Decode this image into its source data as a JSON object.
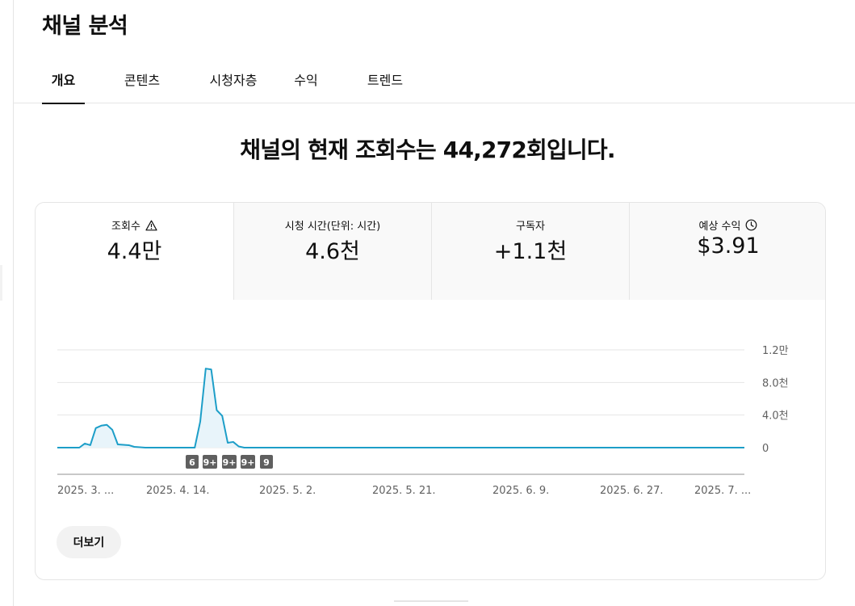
{
  "page_title": "채널 분석",
  "tabs": [
    {
      "label": "개요",
      "active": true
    },
    {
      "label": "콘텐츠",
      "active": false
    },
    {
      "label": "시청자층",
      "active": false
    },
    {
      "label": "수익",
      "active": false
    },
    {
      "label": "트렌드",
      "active": false
    }
  ],
  "headline": "채널의 현재 조회수는 44,272회입니다.",
  "metrics": [
    {
      "label": "조회수",
      "value": "4.4만",
      "icon": "warning-icon",
      "active": true
    },
    {
      "label": "시청 시간(단위: 시간)",
      "value": "4.6천",
      "icon": "",
      "active": false
    },
    {
      "label": "구독자",
      "value": "+1.1천",
      "icon": "",
      "active": false
    },
    {
      "label": "예상 수익",
      "value": "$3.91",
      "icon": "clock-icon",
      "active": false
    }
  ],
  "colors": {
    "line": "#1d9ec8",
    "area": "#e8f4fa",
    "grid": "#e5e5e5",
    "badge": "#5f5f5f"
  },
  "chart_data": {
    "type": "line",
    "x_labels": [
      "2025. 3. ...",
      "2025. 4. 14.",
      "2025. 5. 2.",
      "2025. 5. 21.",
      "2025. 6. 9.",
      "2025. 6. 27.",
      "2025. 7. ..."
    ],
    "y_ticks": [
      "1.2만",
      "8.0천",
      "4.0천",
      "0"
    ],
    "ylim": [
      0,
      12000
    ],
    "series": [
      {
        "values": [
          0,
          0,
          0,
          0,
          0,
          500,
          300,
          2400,
          2700,
          2800,
          2200,
          400,
          350,
          300,
          100,
          50,
          0,
          0,
          0,
          0,
          0,
          0,
          0,
          0,
          0,
          0,
          3200,
          9700,
          9600,
          4600,
          3900,
          600,
          700,
          150,
          0,
          0,
          0,
          0,
          0,
          0,
          0,
          0,
          0,
          0,
          0,
          0,
          0,
          0,
          0,
          0,
          0,
          0,
          0,
          0,
          0,
          0,
          0,
          0,
          0,
          0,
          0,
          0,
          0,
          0,
          0,
          0,
          0,
          0,
          0,
          0,
          0,
          0,
          0,
          0,
          0,
          0,
          0,
          0,
          0,
          0,
          0,
          0,
          0,
          0,
          0,
          0,
          0,
          0,
          0,
          0,
          0,
          0,
          0,
          0,
          0,
          0,
          0,
          0,
          0,
          0,
          0,
          0,
          0,
          0,
          0,
          0,
          0,
          0,
          0,
          0,
          0,
          0,
          0,
          0,
          0,
          0,
          0,
          0,
          0,
          0,
          0,
          0,
          0,
          0,
          0,
          0
        ]
      }
    ],
    "markers": [
      "6",
      "9+",
      "9+",
      "9+",
      "9"
    ],
    "grid": true
  },
  "more_button": "더보기"
}
